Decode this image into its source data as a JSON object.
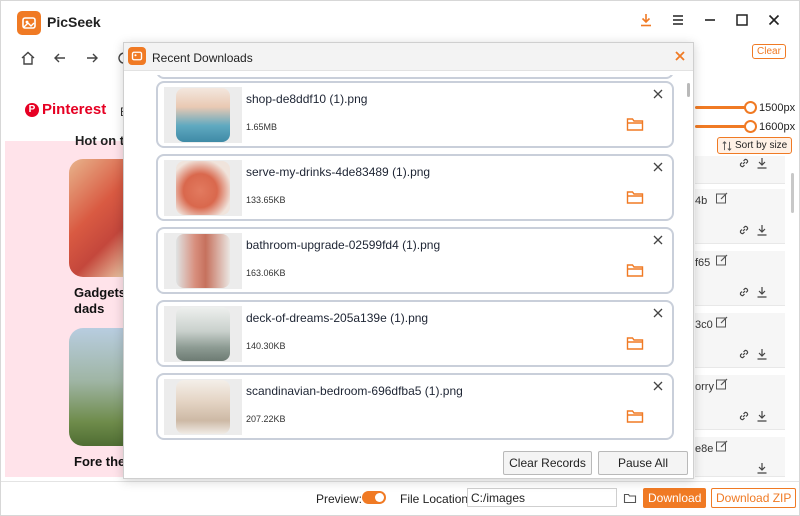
{
  "app": {
    "title": "PicSeek"
  },
  "titlebar": {
    "icons": [
      "download-icon",
      "menu-icon",
      "minimize-icon",
      "maximize-icon",
      "close-icon"
    ]
  },
  "browser_nav": {
    "icons": [
      "home-icon",
      "back-arrow-icon",
      "forward-arrow-icon",
      "refresh-icon"
    ]
  },
  "left_site": {
    "brand": "Pinterest",
    "brand_letter": "P",
    "nav_partial": "E",
    "section_partial": "Hot on th",
    "cards": [
      {
        "caption": "Gadgets\ndads"
      },
      {
        "caption": "Fore the"
      }
    ]
  },
  "right_panel": {
    "clear_label": "Clear",
    "sliders": [
      {
        "value_label": "1500px",
        "fill_fraction": 1.0
      },
      {
        "value_label": "1600px",
        "fill_fraction": 1.0
      }
    ],
    "sort_label": "Sort by size",
    "items": [
      {
        "suffix": ""
      },
      {
        "suffix": "4b"
      },
      {
        "suffix": "f65"
      },
      {
        "suffix": "3c0"
      },
      {
        "suffix": "orry"
      },
      {
        "suffix": "e8e"
      }
    ]
  },
  "modal": {
    "title": "Recent Downloads",
    "items": [
      {
        "filename": "shop-de8ddf10 (1).png",
        "size": "1.65MB",
        "thumb_color": "#6fb5c9"
      },
      {
        "filename": "serve-my-drinks-4de83489 (1).png",
        "size": "133.65KB",
        "thumb_color": "#d9705a"
      },
      {
        "filename": "bathroom-upgrade-02599fd4 (1).png",
        "size": "163.06KB",
        "thumb_color": "#c99a8e"
      },
      {
        "filename": "deck-of-dreams-205a139e (1).png",
        "size": "140.30KB",
        "thumb_color": "#9aa7a1"
      },
      {
        "filename": "scandinavian-bedroom-696dfba5 (1).png",
        "size": "207.22KB",
        "thumb_color": "#d8cbbd"
      }
    ],
    "clear_records_label": "Clear Records",
    "pause_all_label": "Pause All"
  },
  "bottombar": {
    "preview_label": "Preview:",
    "preview_on": true,
    "file_location_label": "File Location",
    "file_location_value": "C:/images",
    "download_label": "Download",
    "download_zip_label": "Download ZIP"
  },
  "colors": {
    "accent": "#f07a24",
    "pinterest_red": "#e60023",
    "pink_bg": "#ffe3ea"
  }
}
